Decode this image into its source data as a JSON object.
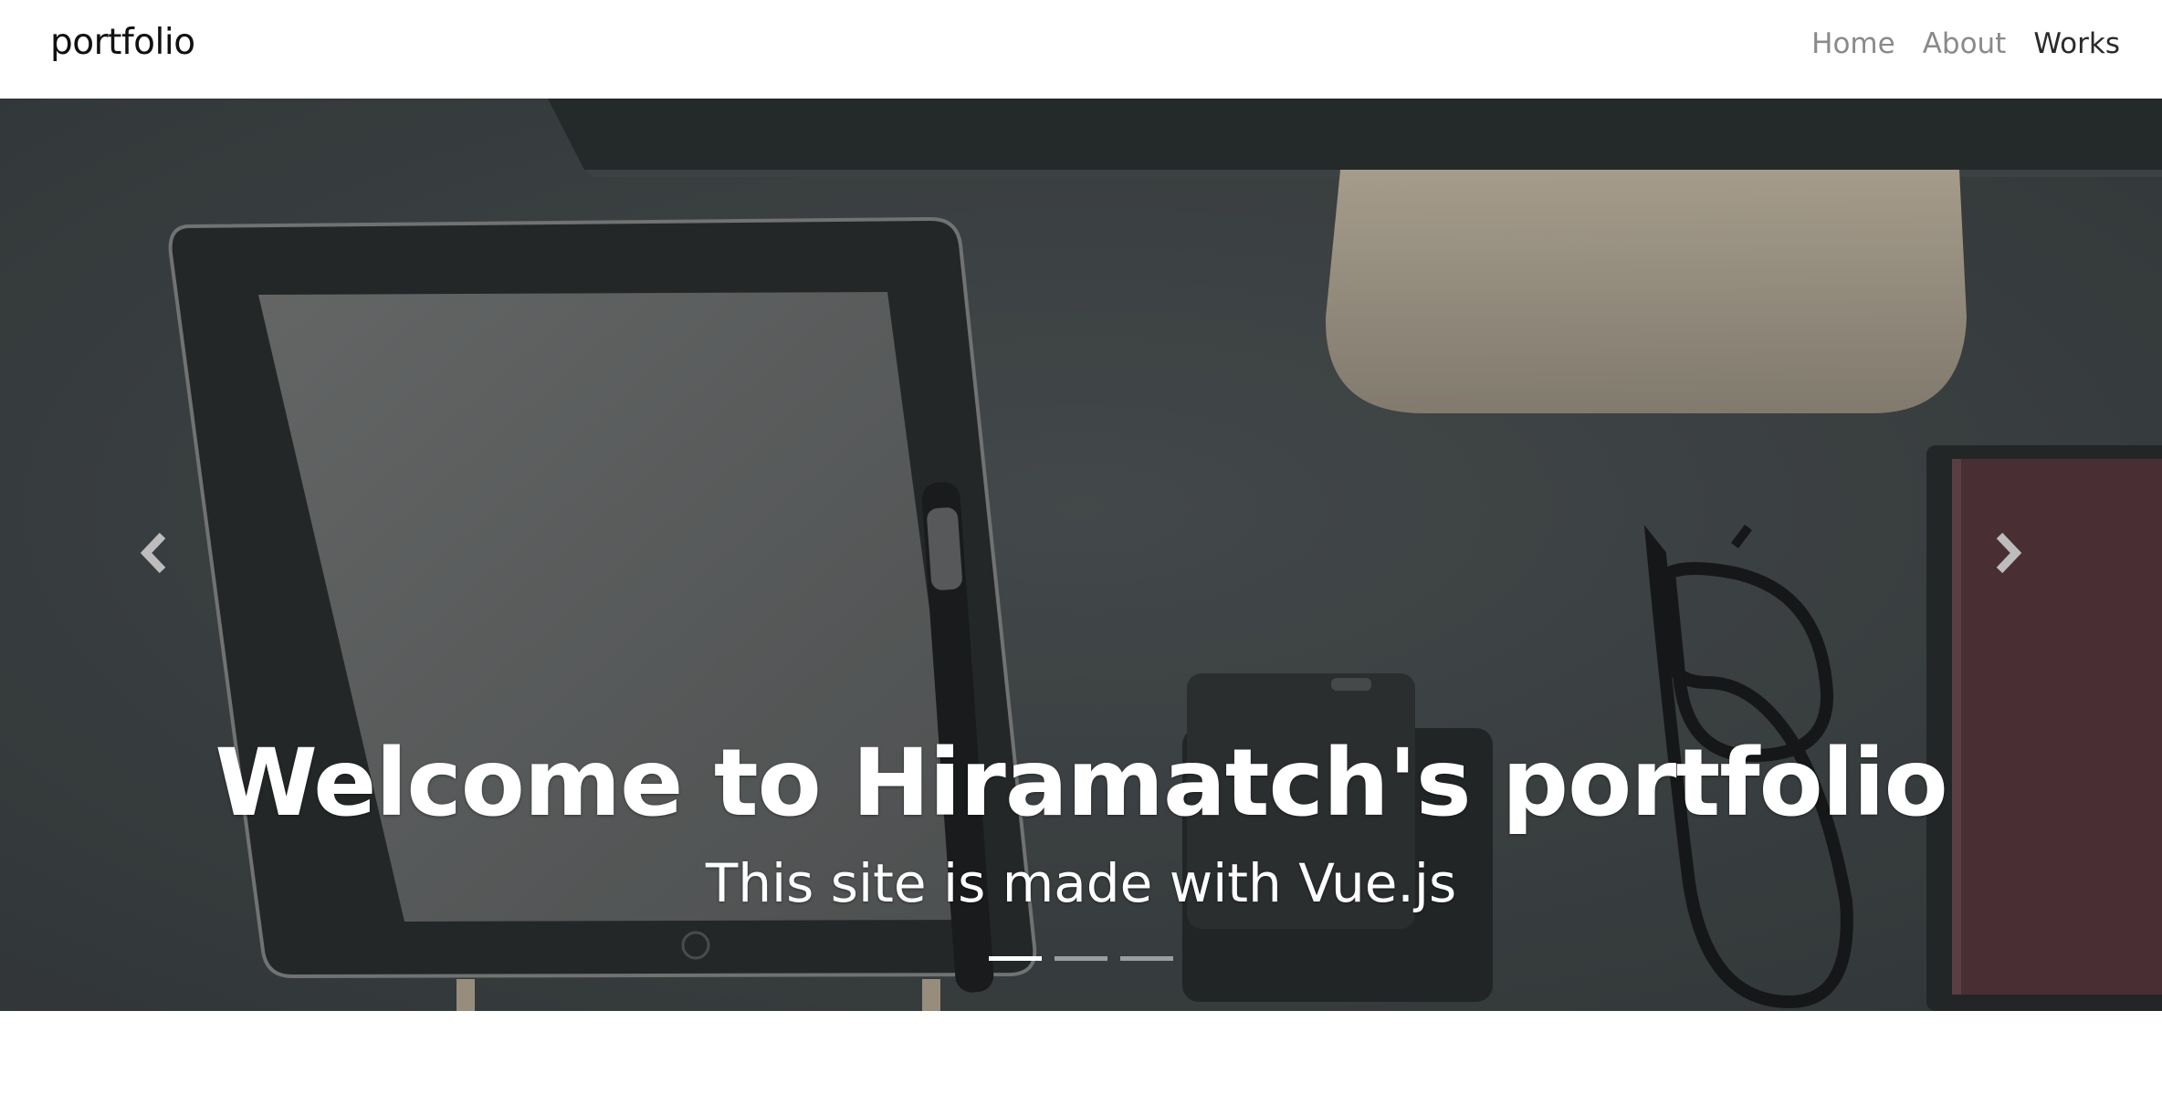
{
  "navbar": {
    "brand": "portfolio",
    "links": [
      {
        "label": "Home",
        "active": false
      },
      {
        "label": "About",
        "active": false
      },
      {
        "label": "Works",
        "active": true
      }
    ]
  },
  "carousel": {
    "slides_count": 3,
    "active_slide": 1,
    "caption": {
      "title": "Welcome to Hiramatch's portfolio",
      "subtitle": "This site is made with Vue.js"
    },
    "prev_icon": "chevron-left-icon",
    "next_icon": "chevron-right-icon"
  },
  "colors": {
    "nav_active": "#2a2a2a",
    "nav_inactive": "#8a8a8a",
    "hero_overlay": "#454a4c"
  }
}
